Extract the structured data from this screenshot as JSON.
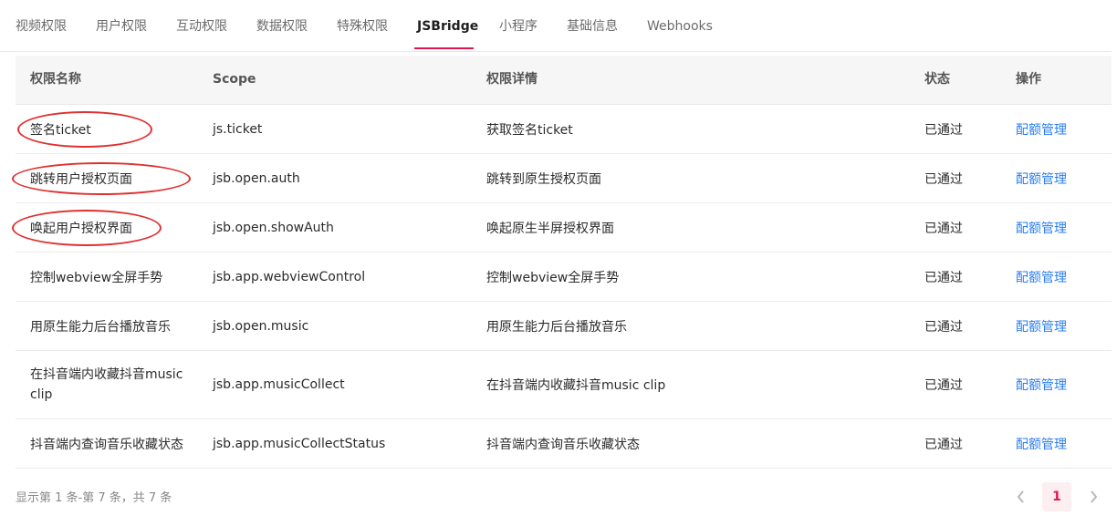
{
  "tabs": [
    {
      "label": "视频权限"
    },
    {
      "label": "用户权限"
    },
    {
      "label": "互动权限"
    },
    {
      "label": "数据权限"
    },
    {
      "label": "特殊权限"
    },
    {
      "label": "JSBridge"
    },
    {
      "label": "小程序"
    },
    {
      "label": "基础信息"
    },
    {
      "label": "Webhooks"
    }
  ],
  "active_tab": "JSBridge",
  "columns": {
    "name": "权限名称",
    "scope": "Scope",
    "detail": "权限详情",
    "status": "状态",
    "action": "操作"
  },
  "rows": [
    {
      "name": "签名ticket",
      "scope": "js.ticket",
      "detail": "获取签名ticket",
      "status": "已通过",
      "action": "配额管理"
    },
    {
      "name": "跳转用户授权页面",
      "scope": "jsb.open.auth",
      "detail": "跳转到原生授权页面",
      "status": "已通过",
      "action": "配额管理"
    },
    {
      "name": "唤起用户授权界面",
      "scope": "jsb.open.showAuth",
      "detail": "唤起原生半屏授权界面",
      "status": "已通过",
      "action": "配额管理"
    },
    {
      "name": "控制webview全屏手势",
      "scope": "jsb.app.webviewControl",
      "detail": "控制webview全屏手势",
      "status": "已通过",
      "action": "配额管理"
    },
    {
      "name": "用原生能力后台播放音乐",
      "scope": "jsb.open.music",
      "detail": "用原生能力后台播放音乐",
      "status": "已通过",
      "action": "配额管理"
    },
    {
      "name": "在抖音端内收藏抖音music clip",
      "scope": "jsb.app.musicCollect",
      "detail": "在抖音端内收藏抖音music clip",
      "status": "已通过",
      "action": "配额管理"
    },
    {
      "name": "抖音端内查询音乐收藏状态",
      "scope": "jsb.app.musicCollectStatus",
      "detail": "抖音端内查询音乐收藏状态",
      "status": "已通过",
      "action": "配额管理"
    }
  ],
  "pagination": {
    "summary": "显示第 1 条-第 7 条，共 7 条",
    "current_page": "1"
  },
  "colors": {
    "accent": "#e0174f",
    "link": "#2a7ef0",
    "annotation": "#e03030"
  }
}
